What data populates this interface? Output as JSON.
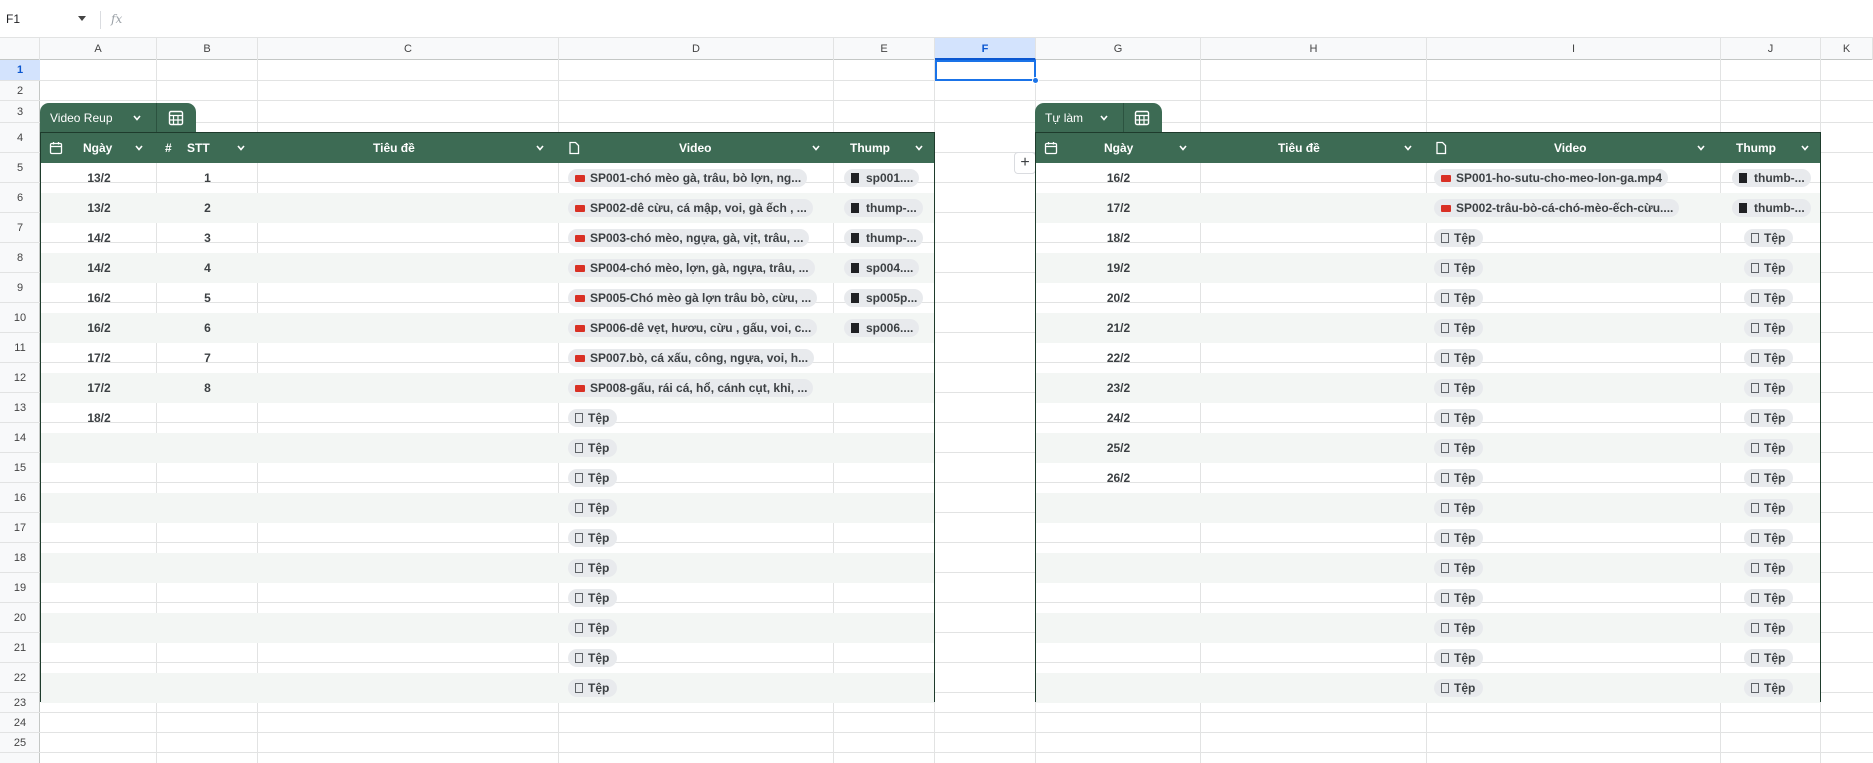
{
  "formula_bar": {
    "cell_ref": "F1",
    "fx_label": "fx"
  },
  "columns": [
    "A",
    "B",
    "C",
    "D",
    "E",
    "F",
    "G",
    "H",
    "I",
    "J",
    "K"
  ],
  "selected_column": "F",
  "rows": [
    "1",
    "2",
    "3",
    "4",
    "5",
    "6",
    "7",
    "8",
    "9",
    "10",
    "11",
    "12",
    "13",
    "14",
    "15",
    "16",
    "17",
    "18",
    "19",
    "20",
    "21",
    "22",
    "23",
    "24",
    "25"
  ],
  "selected_row": "1",
  "table_left": {
    "name": "Video Reup",
    "headers": {
      "date": "Ngày",
      "stt": "STT",
      "title": "Tiêu đề",
      "video": "Video",
      "thump": "Thump"
    },
    "rows": [
      {
        "date": "13/2",
        "stt": "1",
        "video": "SP001-chó mèo gà, trâu, bò lợn, ng...",
        "thump": "sp001...."
      },
      {
        "date": "13/2",
        "stt": "2",
        "video": "SP002-dê cừu, cá mập, voi, gà ếch , ...",
        "thump": "thump-..."
      },
      {
        "date": "14/2",
        "stt": "3",
        "video": "SP003-chó mèo, ngựa, gà, vịt, trâu, ...",
        "thump": "thump-..."
      },
      {
        "date": "14/2",
        "stt": "4",
        "video": "SP004-chó mèo, lợn, gà, ngựa, trâu, ...",
        "thump": "sp004...."
      },
      {
        "date": "16/2",
        "stt": "5",
        "video": "SP005-Chó mèo gà lợn trâu bò, cừu, ...",
        "thump": "sp005p..."
      },
      {
        "date": "16/2",
        "stt": "6",
        "video": "SP006-dê vẹt, hươu, cừu , gấu, voi, c...",
        "thump": "sp006...."
      },
      {
        "date": "17/2",
        "stt": "7",
        "video": "SP007.bò, cá xấu, công, ngựa, voi, h...",
        "thump": ""
      },
      {
        "date": "17/2",
        "stt": "8",
        "video": "SP008-gấu, rái cá, hổ, cánh cụt, khỉ, ...",
        "thump": ""
      },
      {
        "date": "18/2",
        "stt": "",
        "video": "",
        "thump": ""
      },
      {
        "date": "",
        "stt": "",
        "video": "",
        "thump": ""
      },
      {
        "date": "",
        "stt": "",
        "video": "",
        "thump": ""
      },
      {
        "date": "",
        "stt": "",
        "video": "",
        "thump": ""
      },
      {
        "date": "",
        "stt": "",
        "video": "",
        "thump": ""
      },
      {
        "date": "",
        "stt": "",
        "video": "",
        "thump": ""
      },
      {
        "date": "",
        "stt": "",
        "video": "",
        "thump": ""
      },
      {
        "date": "",
        "stt": "",
        "video": "",
        "thump": ""
      },
      {
        "date": "",
        "stt": "",
        "video": "",
        "thump": ""
      },
      {
        "date": "",
        "stt": "",
        "video": "",
        "thump": ""
      }
    ]
  },
  "table_right": {
    "name": "Tự làm",
    "headers": {
      "date": "Ngày",
      "title": "Tiêu đề",
      "video": "Video",
      "thump": "Thump"
    },
    "rows": [
      {
        "date": "16/2",
        "video": "SP001-ho-sutu-cho-meo-lon-ga.mp4",
        "thump": "thumb-..."
      },
      {
        "date": "17/2",
        "video": "SP002-trâu-bò-cá-chó-mèo-ếch-cừu....",
        "thump": "thumb-..."
      },
      {
        "date": "18/2",
        "video": "",
        "thump": ""
      },
      {
        "date": "19/2",
        "video": "",
        "thump": ""
      },
      {
        "date": "20/2",
        "video": "",
        "thump": ""
      },
      {
        "date": "21/2",
        "video": "",
        "thump": ""
      },
      {
        "date": "22/2",
        "video": "",
        "thump": ""
      },
      {
        "date": "23/2",
        "video": "",
        "thump": ""
      },
      {
        "date": "24/2",
        "video": "",
        "thump": ""
      },
      {
        "date": "25/2",
        "video": "",
        "thump": ""
      },
      {
        "date": "26/2",
        "video": "",
        "thump": ""
      },
      {
        "date": "",
        "video": "",
        "thump": ""
      },
      {
        "date": "",
        "video": "",
        "thump": ""
      },
      {
        "date": "",
        "video": "",
        "thump": ""
      },
      {
        "date": "",
        "video": "",
        "thump": ""
      },
      {
        "date": "",
        "video": "",
        "thump": ""
      },
      {
        "date": "",
        "video": "",
        "thump": ""
      },
      {
        "date": "",
        "video": "",
        "thump": ""
      }
    ]
  },
  "empty_file_label": "Tệp",
  "add_button_label": "+",
  "icons": {
    "calendar": "calendar-icon",
    "hash": "hash-icon",
    "file": "file-icon",
    "chevron": "chevron-down-icon",
    "table_view": "table-view-icon"
  },
  "colors": {
    "header_green": "#3d6b54",
    "border_green": "#1e3b2c",
    "selection_blue": "#1a73e8",
    "video_chip_red": "#d93025"
  }
}
